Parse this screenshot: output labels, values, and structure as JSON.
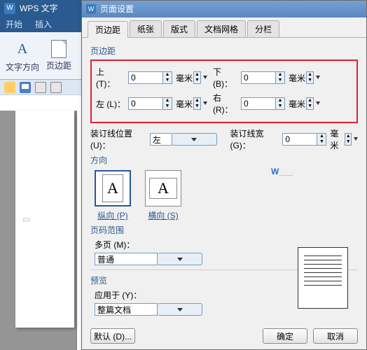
{
  "app": {
    "title": "WPS 文字"
  },
  "ribbon": {
    "tabs": [
      "开始",
      "插入"
    ],
    "btn_text_dir": "文字方向",
    "btn_margins": "页边距"
  },
  "qat": {},
  "dialog": {
    "title": "页面设置",
    "tabs": [
      "页边距",
      "纸张",
      "版式",
      "文档网格",
      "分栏"
    ],
    "margins": {
      "section_label": "页边距",
      "top_label": "上 (T)：",
      "top_value": "0",
      "top_unit": "毫米",
      "bottom_label": "下 (B)：",
      "bottom_value": "0",
      "bottom_unit": "毫米",
      "left_label": "左 (L)：",
      "left_value": "0",
      "left_unit": "毫米",
      "right_label": "右 (R)：",
      "right_value": "0",
      "right_unit": "毫米",
      "gutter_pos_label": "装订线位置 (U)：",
      "gutter_pos_value": "左",
      "gutter_width_label": "装订线宽 (G)：",
      "gutter_width_value": "0",
      "gutter_width_unit": "毫米"
    },
    "orientation": {
      "section_label": "方向",
      "portrait_label": "纵向 (P)",
      "landscape_label": "横向 (S)",
      "glyph": "A"
    },
    "page_range": {
      "section_label": "页码范围",
      "multi_label": "多页 (M)：",
      "value": "普通"
    },
    "preview": {
      "section_label": "预览",
      "apply_label": "应用于 (Y)：",
      "apply_value": "整篇文档"
    },
    "buttons": {
      "default": "默认 (D)...",
      "ok": "确定",
      "cancel": "取消"
    }
  }
}
